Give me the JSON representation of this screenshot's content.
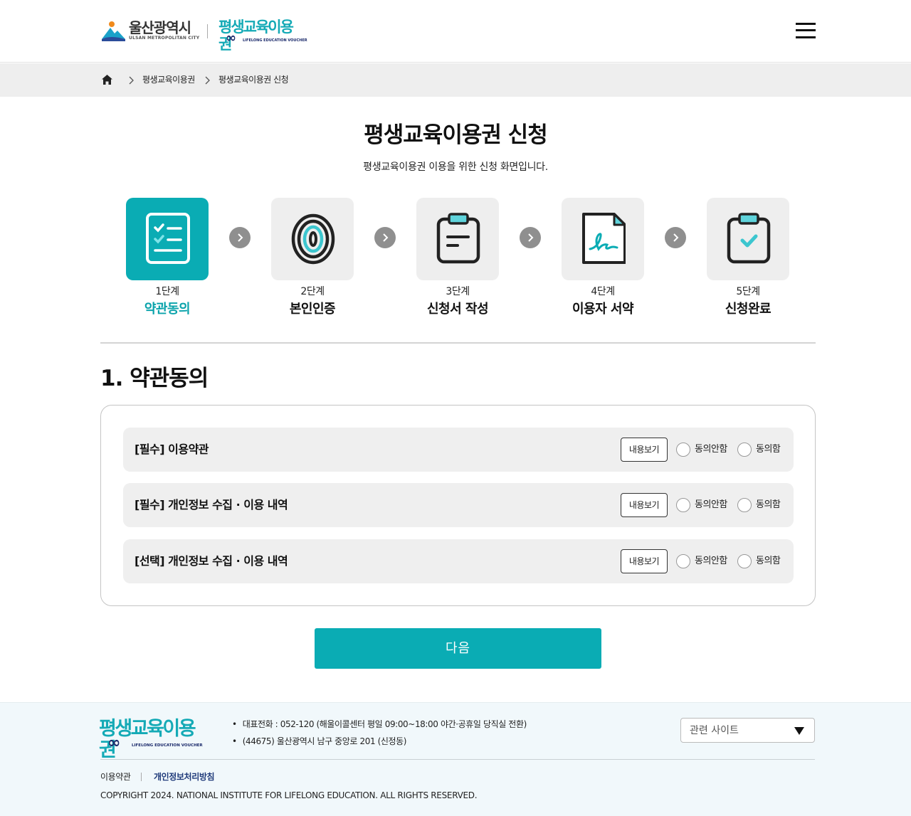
{
  "header": {
    "city_logo_ko": "울산광역시",
    "city_logo_en": "ULSAN METROPOLITAN CITY",
    "voucher_logo_ko": "평생교육이용권",
    "voucher_logo_en": "LIFELONG EDUCATION VOUCHER",
    "menu_icon": "hamburger-menu-icon"
  },
  "breadcrumb": {
    "home_icon": "home-icon",
    "items": [
      "평생교육이용권",
      "평생교육이용권 신청"
    ]
  },
  "page": {
    "title": "평생교육이용권 신청",
    "subtitle": "평생교육이용권 이용을 위한 신청 화면입니다."
  },
  "steps": [
    {
      "num": "1단계",
      "name": "약관동의",
      "icon": "checklist-icon",
      "active": true
    },
    {
      "num": "2단계",
      "name": "본인인증",
      "icon": "fingerprint-icon",
      "active": false
    },
    {
      "num": "3단계",
      "name": "신청서 작성",
      "icon": "clipboard-form-icon",
      "active": false
    },
    {
      "num": "4단계",
      "name": "이용자 서약",
      "icon": "signature-document-icon",
      "active": false
    },
    {
      "num": "5단계",
      "name": "신청완료",
      "icon": "clipboard-check-icon",
      "active": false
    }
  ],
  "section": {
    "title": "1. 약관동의"
  },
  "terms": [
    {
      "label": "[필수] 이용약관",
      "view": "내용보기",
      "disagree": "동의안함",
      "agree": "동의함"
    },
    {
      "label": "[필수] 개인정보 수집 · 이용 내역",
      "view": "내용보기",
      "disagree": "동의안함",
      "agree": "동의함"
    },
    {
      "label": "[선택] 개인정보 수집 · 이용 내역",
      "view": "내용보기",
      "disagree": "동의안함",
      "agree": "동의함"
    }
  ],
  "next_button": "다음",
  "footer": {
    "logo_ko": "평생교육이용권",
    "logo_en": "LIFELONG EDUCATION VOUCHER",
    "phone": "대표전화 : 052-120 (해울이콜센터 평일 09:00~18:00 야간·공휴일 당직실 전환)",
    "address": "(44675) 울산광역시 남구 중앙로 201 (신정동)",
    "related_sites": "관련 사이트",
    "link_terms": "이용약관",
    "link_privacy": "개인정보처리방침",
    "copyright": "COPYRIGHT 2024. NATIONAL INSTITUTE FOR LIFELONG EDUCATION. ALL RIGHTS RESERVED."
  },
  "colors": {
    "accent": "#0aacb4",
    "step_inactive_bg": "#eeeeee",
    "arrow_circle": "#8f8f8f",
    "navy": "#1b2a6b"
  }
}
